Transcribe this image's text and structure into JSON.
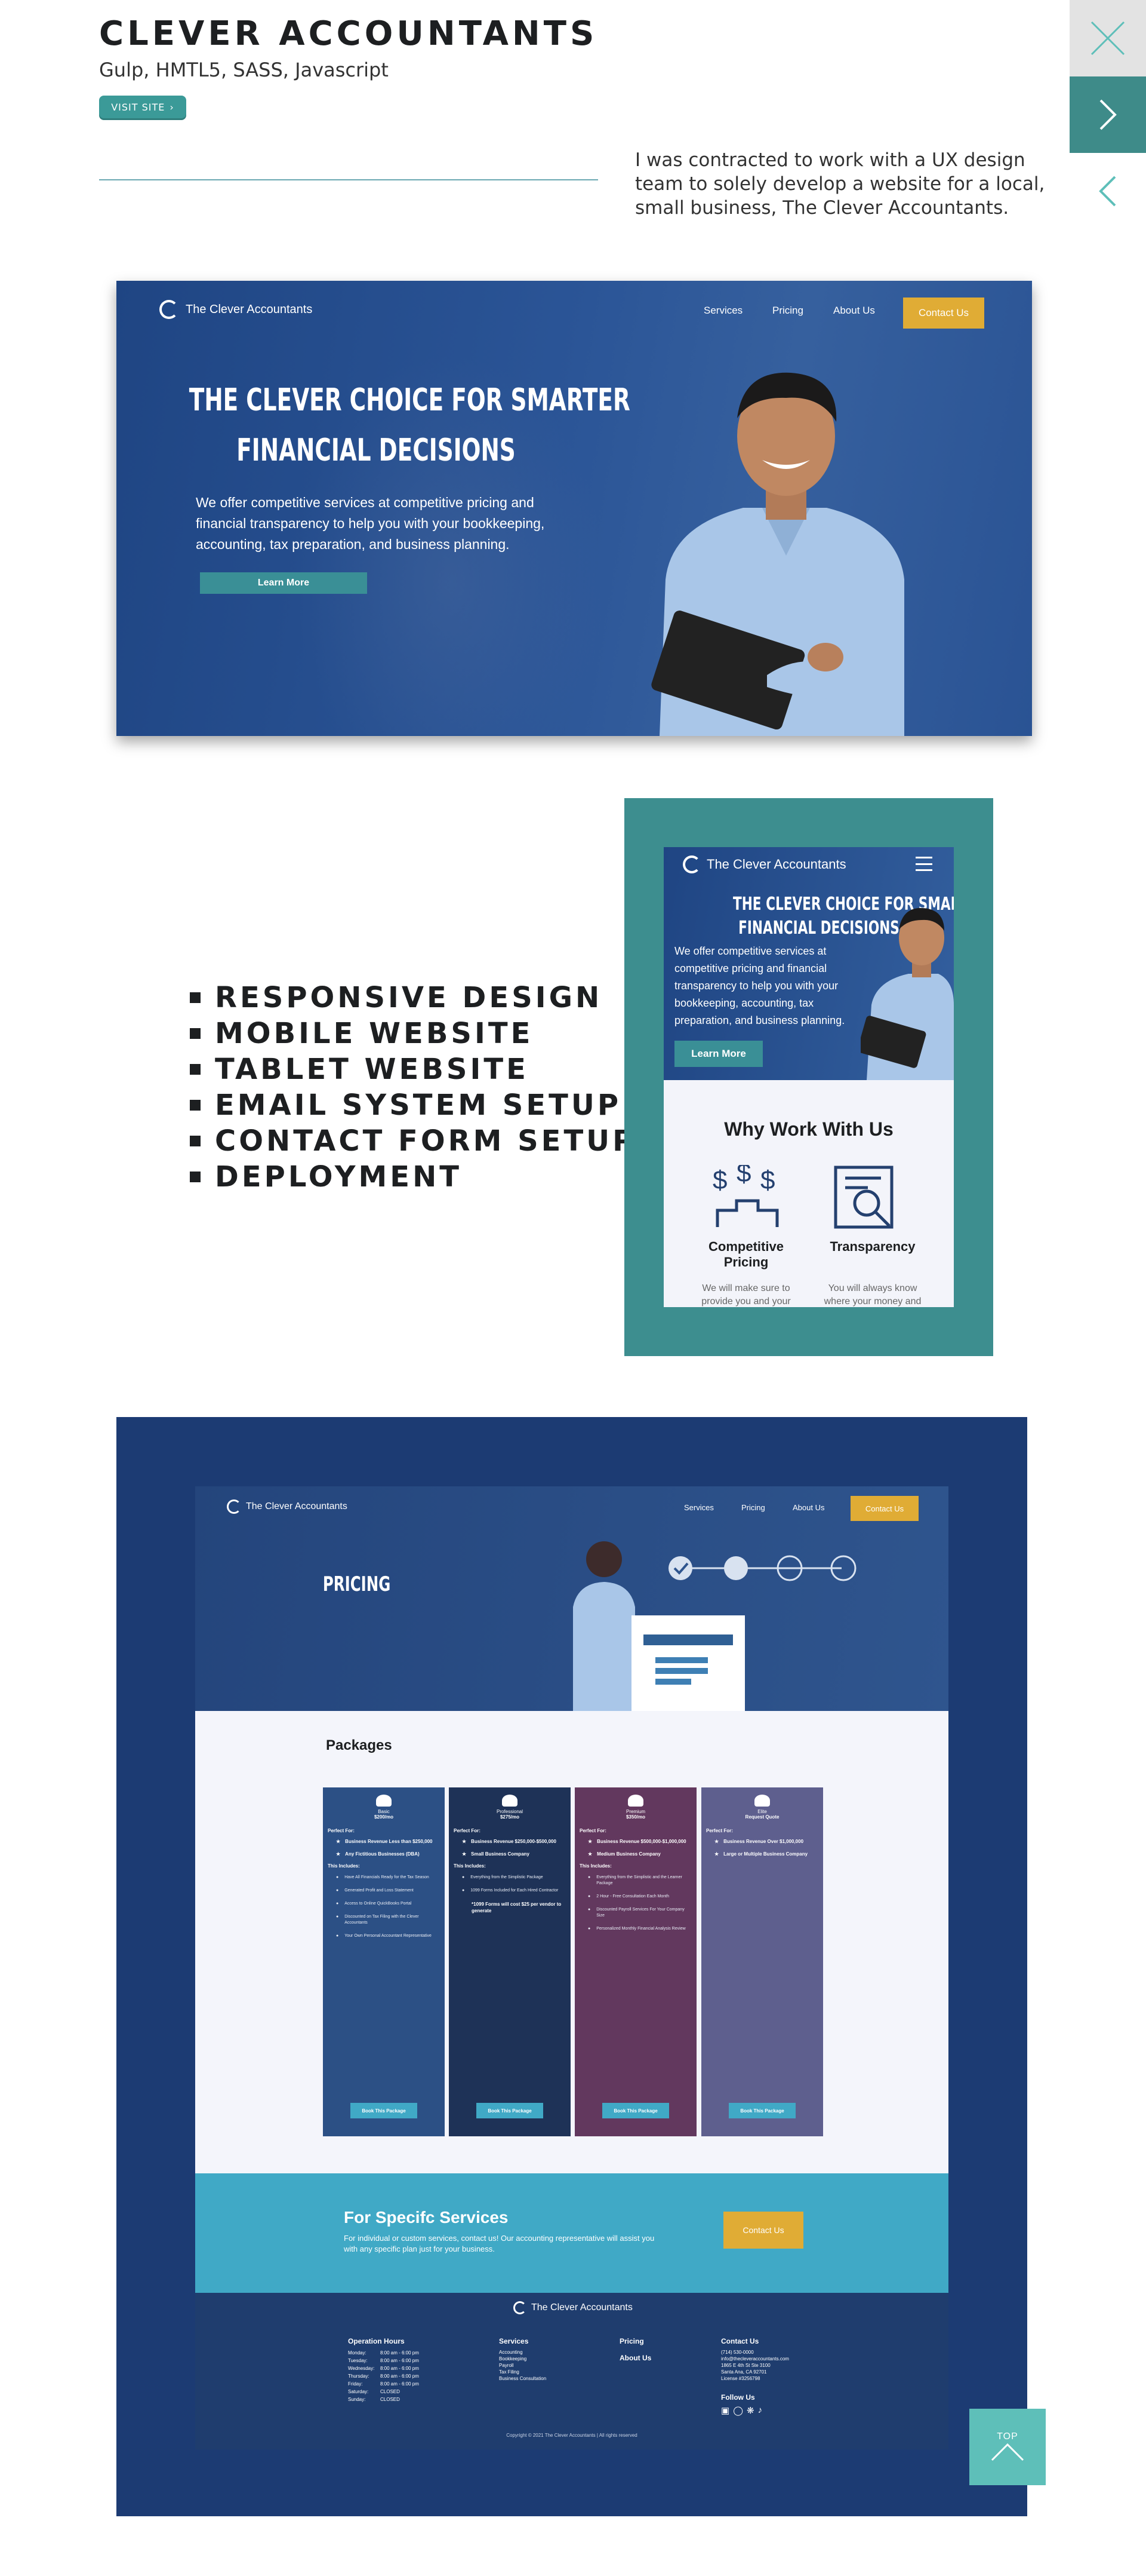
{
  "project": {
    "title": "Clever Accountants",
    "subtitle": "Gulp, HMTL5, SASS, Javascript",
    "visit_label": "VISIT SITE",
    "description": "I was contracted to work with a UX design team to solely develop a website for a local, small business, The Clever Accountants."
  },
  "side_nav": {
    "close_icon": "close-icon",
    "next_icon": "chevron-right-icon",
    "prev_icon": "chevron-left-icon"
  },
  "site": {
    "brand": "The Clever Accountants",
    "nav": [
      "Services",
      "Pricing",
      "About Us"
    ],
    "contact_label": "Contact Us",
    "hero_heading_1": "THE CLEVER CHOICE FOR SMARTER",
    "hero_heading_2": "FINANCIAL DECISIONS",
    "hero_text": "We offer competitive services at competitive pricing and financial transparency to help you with your bookkeeping, accounting, tax preparation, and business planning.",
    "learn_more": "Learn More"
  },
  "features": [
    "Responsive Design",
    "Mobile Website",
    "Tablet Website",
    "Email System Setup",
    "Contact Form Setup",
    "Deployment"
  ],
  "mobile": {
    "why_heading": "Why Work With Us",
    "items": [
      {
        "title_1": "Competitive",
        "title_2": "Pricing",
        "text_1": "We will make sure to",
        "text_2": "provide you and your"
      },
      {
        "title_1": "Transparency",
        "title_2": "",
        "text_1": "You will always know",
        "text_2": "where your money and"
      }
    ]
  },
  "pricing": {
    "hero_title": "PRICING",
    "packages_heading": "Packages",
    "packages": [
      {
        "name": "Basic",
        "price": "$200/mo",
        "color": "#2c5085",
        "perfect": [
          "Business Revenue Less than $250,000",
          "Any Fictitious Businesses (DBA)"
        ],
        "includes": [
          "Have All Financials Ready for the Tax Season",
          "Generated Profit and Loss Statement",
          "Access to Online QuickBooks Portal",
          "Discounted on Tax Filing with the Clever Accountants",
          "Your Own Personal Accountant Representative"
        ],
        "extra": ""
      },
      {
        "name": "Professional",
        "price": "$275/mo",
        "color": "#1e3257",
        "perfect": [
          "Business Revenue $250,000-$500,000",
          "Small Business Company"
        ],
        "includes": [
          "Everything from the Simplistic Package",
          "1099 Forms Included for Each Hired Contractor"
        ],
        "extra": "*1099 Forms will cost $25 per vendor to generate"
      },
      {
        "name": "Premium",
        "price": "$350/mo",
        "color": "#62385e",
        "perfect": [
          "Business Revenue $500,000-$1,000,000",
          "Medium Business Company"
        ],
        "includes": [
          "Everything from the Simplistic and the Learner Package",
          "2 Hour - Free Consultation Each Month",
          "Discounted Payroll Services For Your Company Size",
          "Personalized Monthly Financial Analysis Review"
        ],
        "extra": ""
      },
      {
        "name": "Elite",
        "price": "Request Quote",
        "color": "#5e5f8e",
        "perfect": [
          "Business Revenue Over $1,000,000",
          "Large or Multiple Business Company"
        ],
        "includes": [],
        "extra": ""
      }
    ],
    "perfect_for": "Perfect For:",
    "this_includes": "This Includes:",
    "book_label": "Book This Package",
    "specific_heading": "For Specifc Services",
    "specific_text": "For individual or custom services, contact us! Our accounting representative will assist you with any specific plan just for your business.",
    "footer": {
      "hours_heading": "Operation Hours",
      "hours": [
        [
          "Monday:",
          "8:00 am - 6:00 pm"
        ],
        [
          "Tuesday:",
          "8:00 am - 6:00 pm"
        ],
        [
          "Wednesday:",
          "8:00 am - 6:00 pm"
        ],
        [
          "Thursday:",
          "8:00 am - 6:00 pm"
        ],
        [
          "Friday:",
          "8:00 am - 6:00 pm"
        ],
        [
          "Saturday:",
          "CLOSED"
        ],
        [
          "Sunday:",
          "CLOSED"
        ]
      ],
      "services_heading": "Services",
      "services": [
        "Accounting",
        "Bookkeeping",
        "Payroll",
        "Tax Filing",
        "Business Consultation"
      ],
      "pricing_heading": "Pricing",
      "about_heading": "About Us",
      "contact_heading": "Contact Us",
      "contact_lines": [
        "(714) 530-0000",
        "info@thecleveraccountants.com",
        "1865 E 4th St Ste 3100",
        "Santa Ana, CA 92701",
        "License #3256798"
      ],
      "follow": "Follow Us",
      "copyright": "Copyright © 2021 The Clever Accountants | All rights reserved"
    }
  },
  "top_label": "TOP"
}
